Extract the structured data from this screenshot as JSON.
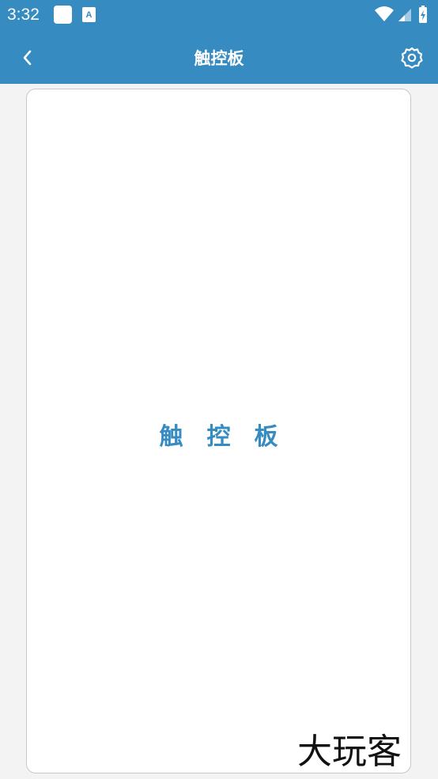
{
  "status_bar": {
    "time": "3:32",
    "icons": [
      "notification-square-icon",
      "a-badge-icon",
      "wifi-icon",
      "cell-signal-icon",
      "battery-charging-icon"
    ]
  },
  "app_bar": {
    "title": "触控板",
    "back_icon": "chevron-left-icon",
    "settings_icon": "gear-icon"
  },
  "touchpad": {
    "label": "触控板"
  },
  "watermark": {
    "text": "大玩客"
  },
  "colors": {
    "primary": "#368bc1",
    "background": "#f3f3f3",
    "panel": "#ffffff",
    "panel_border": "#c8c8c8"
  }
}
